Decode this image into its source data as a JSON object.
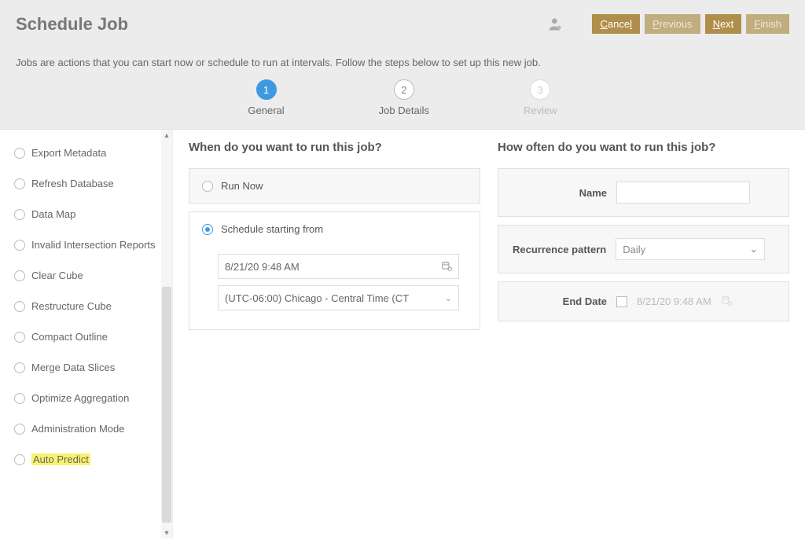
{
  "header": {
    "title": "Schedule Job",
    "subtitle": "Jobs are actions that you can start now or schedule to run at intervals. Follow the steps below to set up this new job.",
    "buttons": {
      "cancel": "Cancel",
      "previous": "Previous",
      "next": "Next",
      "finish": "Finish"
    }
  },
  "stepper": {
    "step1": {
      "num": "1",
      "label": "General"
    },
    "step2": {
      "num": "2",
      "label": "Job Details"
    },
    "step3": {
      "num": "3",
      "label": "Review"
    }
  },
  "sidebar": {
    "items": [
      {
        "label": "Export Metadata"
      },
      {
        "label": "Refresh Database"
      },
      {
        "label": "Data Map"
      },
      {
        "label": "Invalid Intersection Reports"
      },
      {
        "label": "Clear Cube"
      },
      {
        "label": "Restructure Cube"
      },
      {
        "label": "Compact Outline"
      },
      {
        "label": "Merge Data Slices"
      },
      {
        "label": "Optimize Aggregation"
      },
      {
        "label": "Administration Mode"
      },
      {
        "label": "Auto Predict"
      }
    ]
  },
  "when": {
    "title": "When do you want to run this job?",
    "runNow": "Run Now",
    "scheduleFrom": "Schedule starting from",
    "datetime": "8/21/20 9:48 AM",
    "timezone": "(UTC-06:00) Chicago - Central Time (CT"
  },
  "how": {
    "title": "How often do you want to run this job?",
    "nameLabel": "Name",
    "nameValue": "",
    "patternLabel": "Recurrence pattern",
    "patternValue": "Daily",
    "endDateLabel": "End Date",
    "endDateValue": "8/21/20 9:48 AM"
  }
}
